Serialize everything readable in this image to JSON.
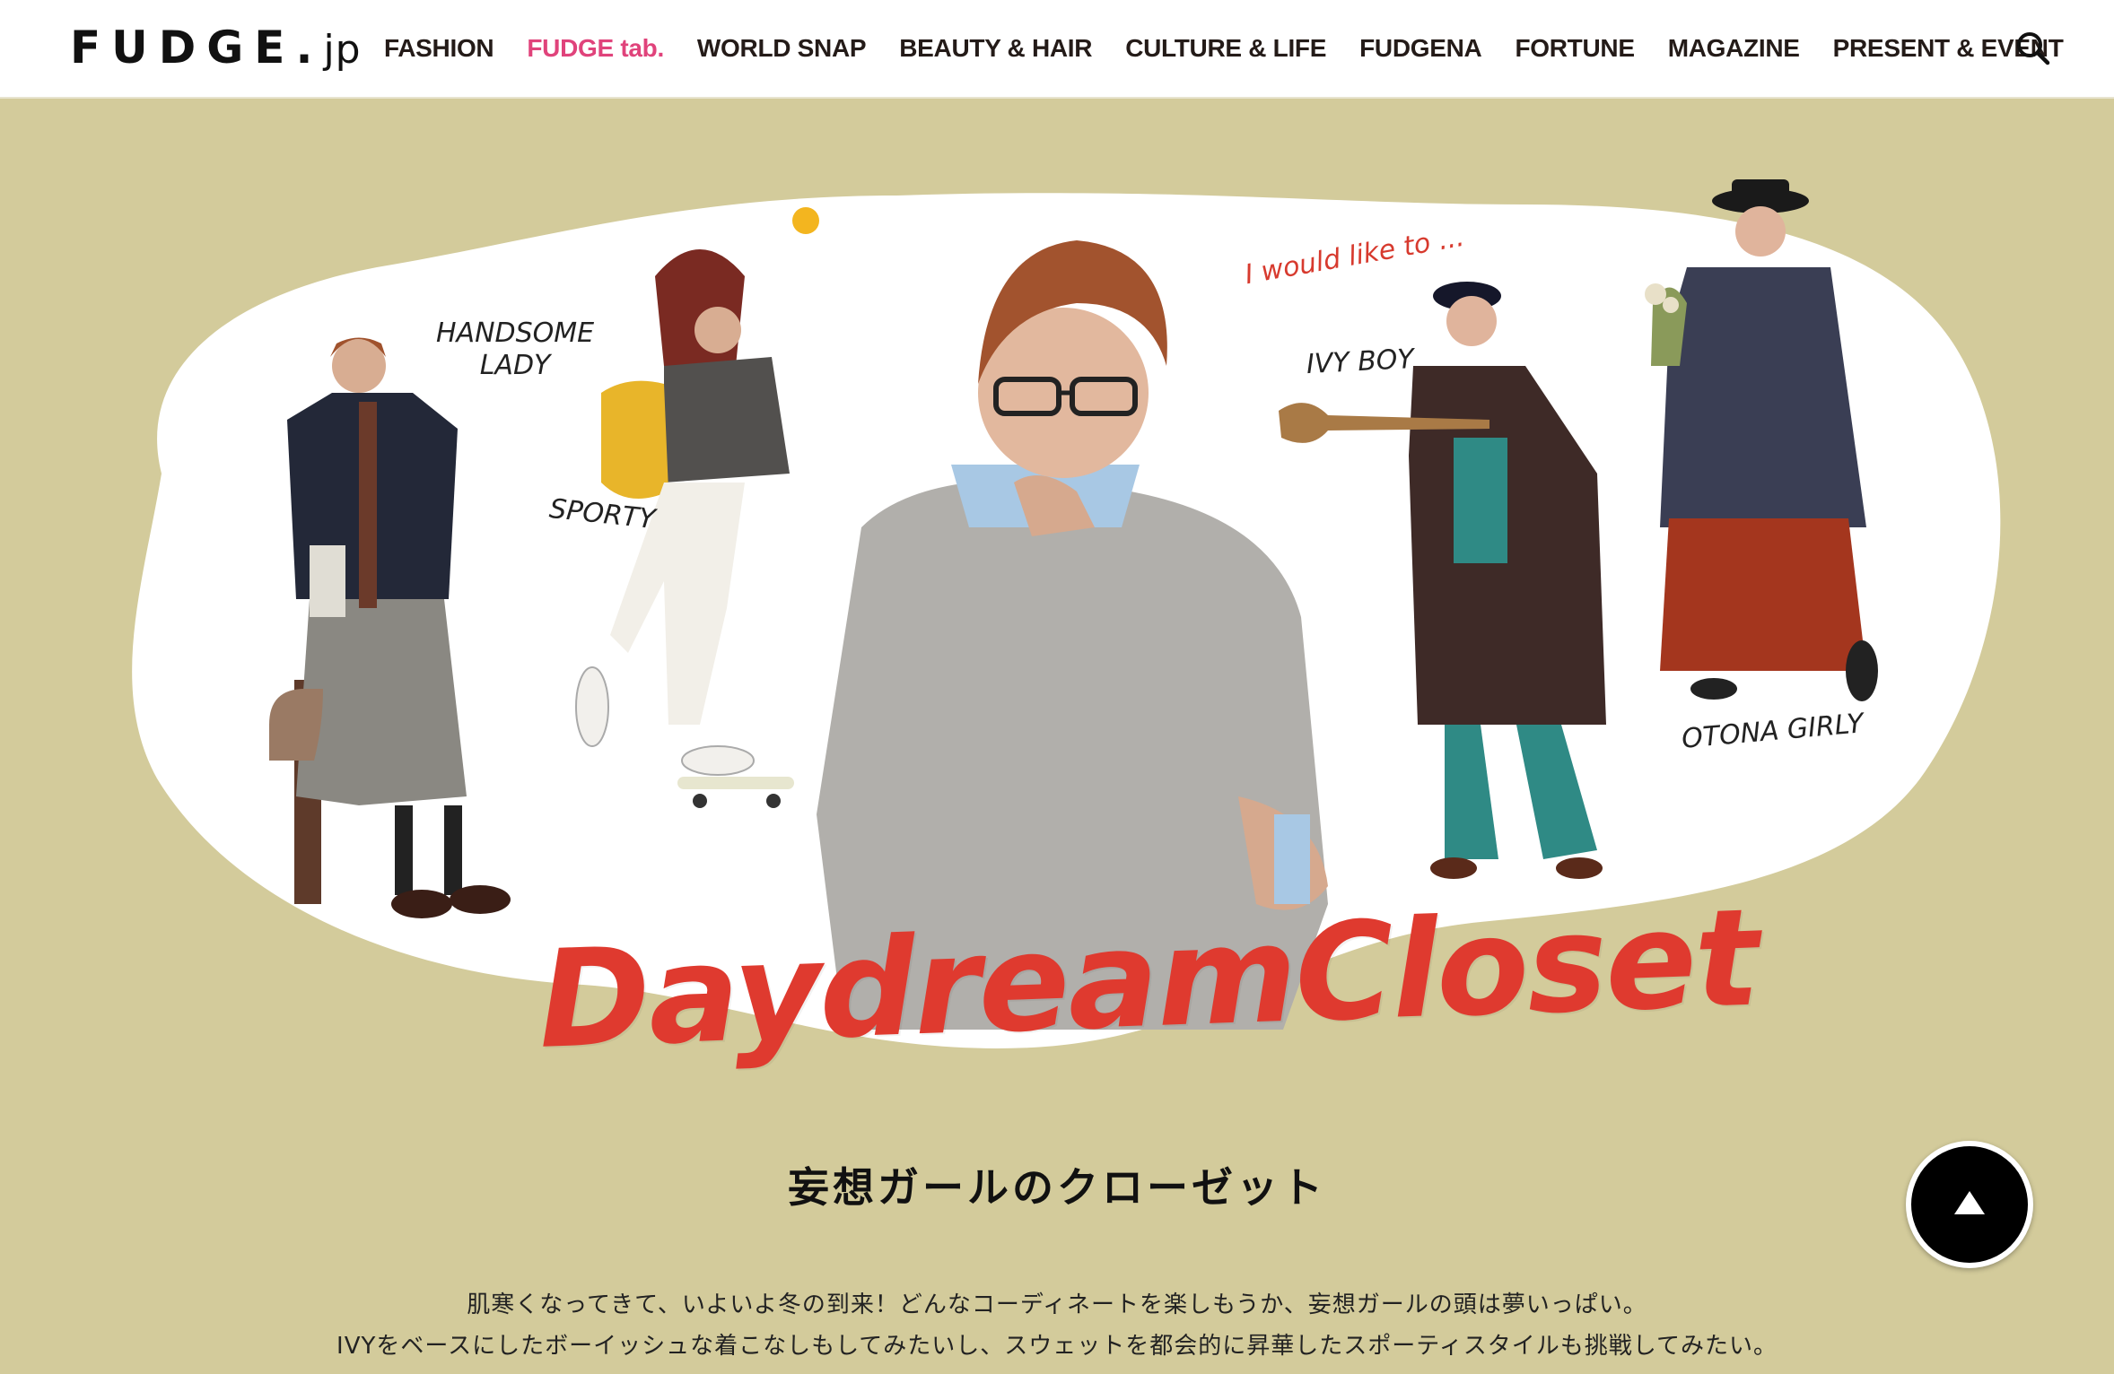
{
  "header": {
    "logo_main": "FUDGE.",
    "logo_sub": "jp",
    "nav": [
      {
        "label": "FASHION",
        "active": false
      },
      {
        "label": "FUDGE tab.",
        "active": true
      },
      {
        "label": "WORLD SNAP",
        "active": false
      },
      {
        "label": "BEAUTY & HAIR",
        "active": false
      },
      {
        "label": "CULTURE & LIFE",
        "active": false
      },
      {
        "label": "FUDGENA",
        "active": false
      },
      {
        "label": "FORTUNE",
        "active": false
      },
      {
        "label": "MAGAZINE",
        "active": false
      },
      {
        "label": "PRESENT & EVENT",
        "active": false
      }
    ],
    "search_icon": "search-icon"
  },
  "hero": {
    "tags": {
      "handsome_lady_1": "HANDSOME",
      "handsome_lady_2": "LADY",
      "sporty": "SPORTY",
      "would_like": "I would like to ...",
      "ivy_boy": "IVY BOY",
      "otona_girly": "OTONA GIRLY"
    },
    "title": "DaydreamCloset"
  },
  "content": {
    "heading": "妄想ガールのクローゼット",
    "line1": "肌寒くなってきて、いよいよ冬の到来！どんなコーディネートを楽しもうか、妄想ガールの頭は夢いっぱい。",
    "line2": "IVYをベースにしたボーイッシュな着こなしもしてみたいし、スウェットを都会的に昇華したスポーティスタイルも挑戦してみたい。"
  },
  "colors": {
    "background": "#d3cb9b",
    "accent_pink": "#e0437b",
    "title_red": "#df3a2f",
    "header_bg": "#ffffff"
  },
  "back_to_top_icon": "arrow-up-icon"
}
